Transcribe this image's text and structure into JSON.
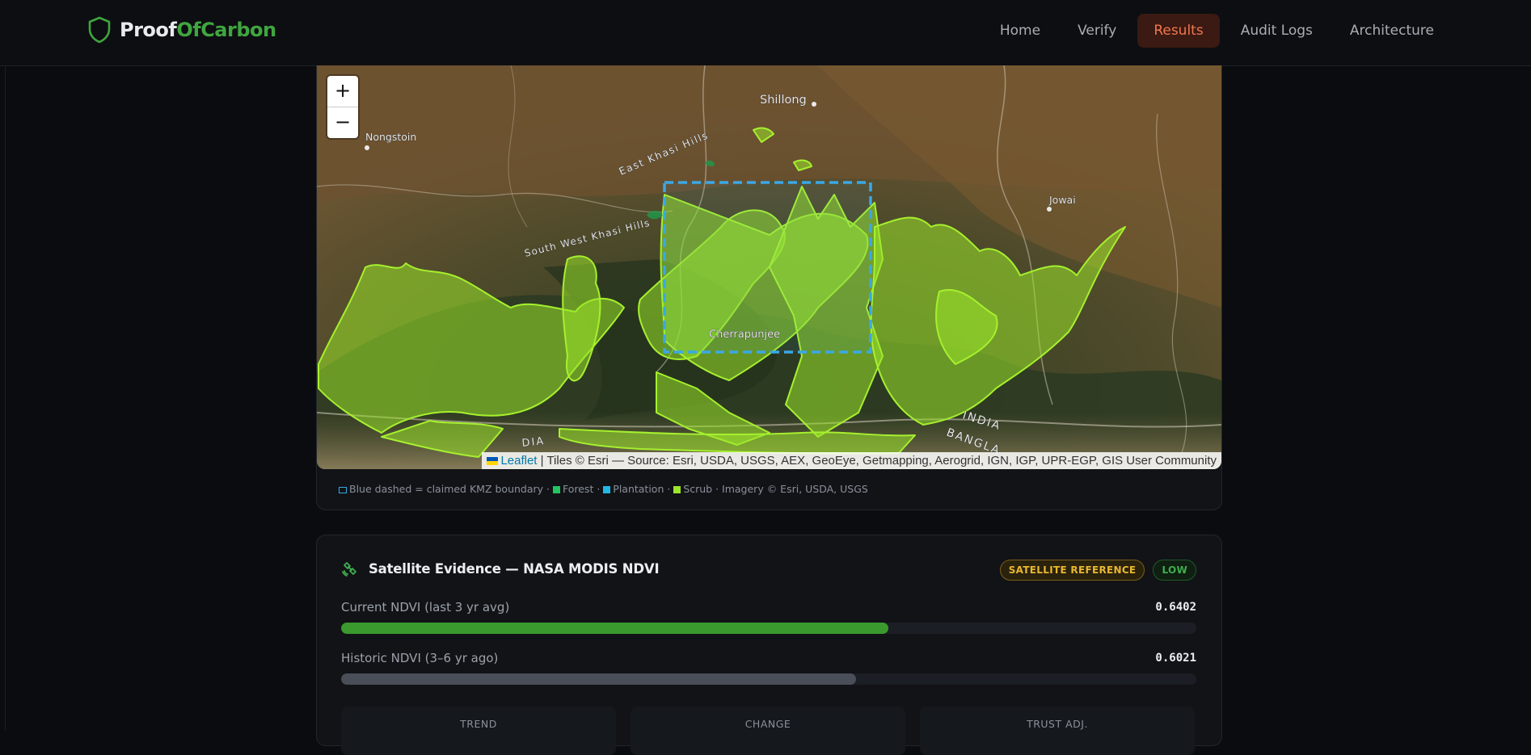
{
  "brand": {
    "part1": "Proof",
    "part2": "OfCarbon",
    "icon": "shield-icon"
  },
  "nav": {
    "items": [
      {
        "label": "Home"
      },
      {
        "label": "Verify"
      },
      {
        "label": "Results",
        "active": true
      },
      {
        "label": "Audit Logs"
      },
      {
        "label": "Architecture"
      }
    ]
  },
  "map": {
    "zoom_in": "+",
    "zoom_out": "−",
    "place_labels": {
      "shillong": "Shillong",
      "nongstoin": "Nongstoin",
      "east_khasi": "East Khasi Hills",
      "south_west_khasi": "South West Khasi Hills",
      "jowai": "Jowai",
      "cherrapunjee": "Cherrapunjee",
      "india": "INDIA",
      "bangla": "BANGLA",
      "dia": "DIA"
    },
    "attribution": {
      "leaflet": "Leaflet",
      "tiles": "| Tiles © Esri — Source: Esri, USDA, USGS, AEX, GeoEye, Getmapping, Aerogrid, IGN, IGP, UPR-EGP, GIS User Community"
    },
    "legend": {
      "boundary": "Blue dashed = claimed KMZ boundary ·",
      "forest": "Forest ·",
      "plantation": "Plantation ·",
      "scrub": "Scrub · Imagery © Esri, USDA, USGS"
    },
    "colors": {
      "boundary": "#3aa8e6",
      "forest": "#22c55e",
      "plantation": "#22b8e6",
      "scrub": "#9be52a"
    }
  },
  "evidence": {
    "icon": "satellite-icon",
    "title": "Satellite Evidence — NASA MODIS NDVI",
    "badges": {
      "reference": "SATELLITE REFERENCE",
      "level": "LOW"
    },
    "current": {
      "label": "Current NDVI (last 3 yr avg)",
      "value": "0.6402",
      "fill_fraction": 0.6402
    },
    "historic": {
      "label": "Historic NDVI (3–6 yr ago)",
      "value": "0.6021",
      "fill_fraction": 0.6021
    },
    "stats": {
      "trend": "TREND",
      "change": "CHANGE",
      "trust": "TRUST ADJ."
    }
  }
}
